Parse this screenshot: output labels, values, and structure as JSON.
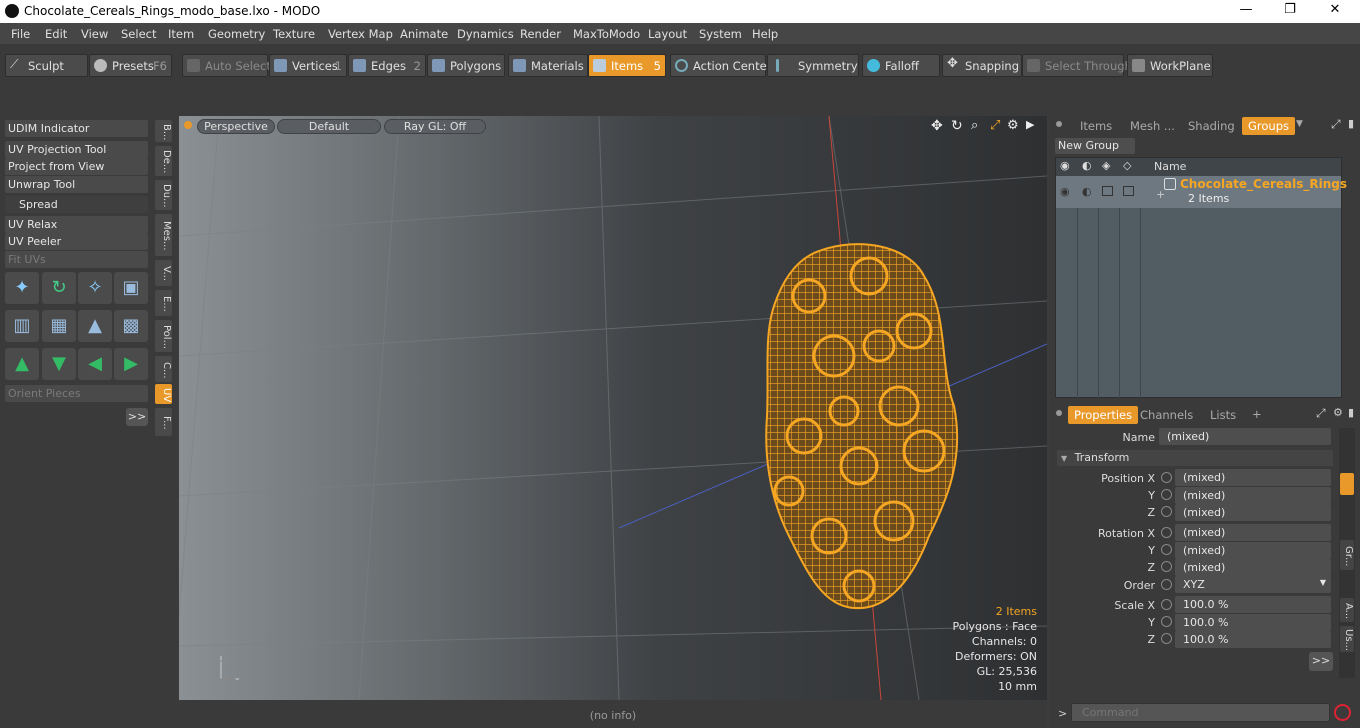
{
  "window": {
    "title": "Chocolate_Cereals_Rings_modo_base.lxo - MODO",
    "minimize": "—",
    "maximize": "❐",
    "close": "✕"
  },
  "menu": [
    "File",
    "Edit",
    "View",
    "Select",
    "Item",
    "Geometry",
    "Texture",
    "Vertex Map",
    "Animate",
    "Dynamics",
    "Render",
    "MaxToModo",
    "Layout",
    "System",
    "Help"
  ],
  "toolbar": {
    "sculpt": "Sculpt",
    "presets": "Presets",
    "presets_key": "F6",
    "auto_select": "Auto Select",
    "vertices": "Vertices",
    "vertices_n": "1",
    "edges": "Edges",
    "edges_n": "2",
    "polygons": "Polygons",
    "materials": "Materials",
    "items": "Items",
    "items_n": "5",
    "action_center": "Action Center",
    "symmetry": "Symmetry",
    "falloff": "Falloff",
    "snapping": "Snapping",
    "select_through": "Select Through",
    "workplane": "WorkPlane"
  },
  "left": {
    "tools": [
      "UDIM Indicator",
      "UV Projection Tool",
      "Project from View",
      "Unwrap Tool",
      "Spread",
      "UV Relax",
      "UV Peeler",
      "Fit UVs"
    ],
    "orient": "Orient Pieces",
    "more": ">>",
    "vtabs": [
      "B...",
      "De...",
      "Du...",
      "Mes...",
      "V...",
      "E...",
      "Pol...",
      "C...",
      "UV",
      "F..."
    ]
  },
  "viewport": {
    "view": "Perspective",
    "shading": "Default",
    "raygl": "Ray GL: Off",
    "info": [
      "2 Items",
      "Polygons : Face",
      "Channels: 0",
      "Deformers: ON",
      "GL: 25,536",
      "10 mm"
    ],
    "status": "(no info)"
  },
  "groups": {
    "tabs": [
      "Items",
      "Mesh ...",
      "Shading",
      "Groups"
    ],
    "new_group": "New Group",
    "col_name": "Name",
    "row_name": "Chocolate_Cereals_Rings",
    "row_count": "2 Items"
  },
  "properties": {
    "tabs": [
      "Properties",
      "Channels",
      "Lists",
      "+"
    ],
    "name_label": "Name",
    "name_value": "(mixed)",
    "transform": "Transform",
    "rows": [
      {
        "label": "Position X",
        "value": "(mixed)"
      },
      {
        "label": "Y",
        "value": "(mixed)"
      },
      {
        "label": "Z",
        "value": "(mixed)"
      },
      {
        "label": "Rotation X",
        "value": "(mixed)"
      },
      {
        "label": "Y",
        "value": "(mixed)"
      },
      {
        "label": "Z",
        "value": "(mixed)"
      },
      {
        "label": "Order",
        "value": "XYZ"
      },
      {
        "label": "Scale X",
        "value": "100.0 %"
      },
      {
        "label": "Y",
        "value": "100.0 %"
      },
      {
        "label": "Z",
        "value": "100.0 %"
      }
    ],
    "more": ">>",
    "side_tabs": [
      "Gr...",
      "A...",
      "Us..."
    ]
  },
  "command": {
    "prompt": ">",
    "placeholder": "Command"
  },
  "colors": {
    "accent": "#e8992a",
    "selection": "#f5a623"
  }
}
